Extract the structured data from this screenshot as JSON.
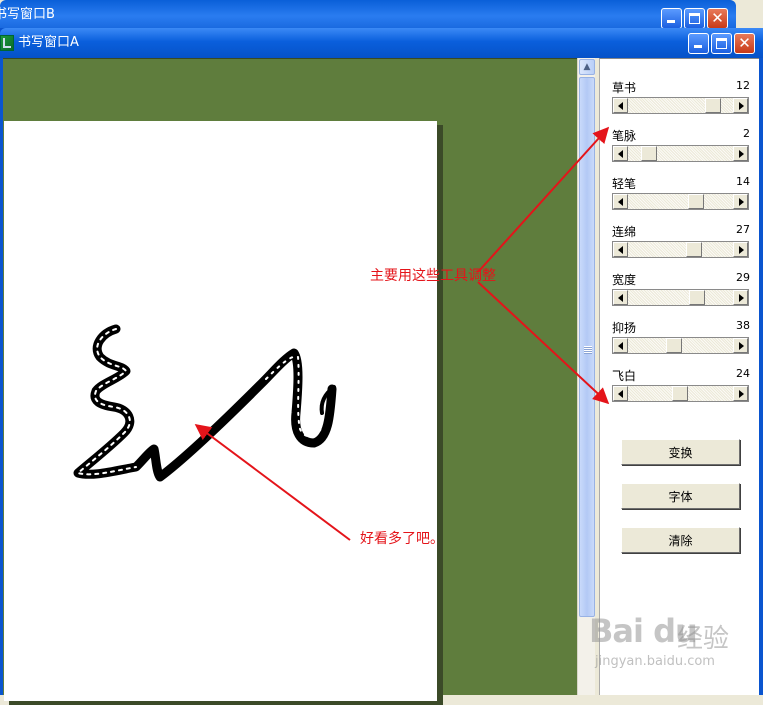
{
  "window_b": {
    "title": "书写窗口B"
  },
  "window_a": {
    "title": "书写窗口A"
  },
  "panel": {
    "sliders": [
      {
        "label": "草书",
        "value": "12",
        "level": 0.85
      },
      {
        "label": "笔脉",
        "value": "2",
        "level": 0.14
      },
      {
        "label": "轻笔",
        "value": "14",
        "level": 0.66
      },
      {
        "label": "连绵",
        "value": "27",
        "level": 0.64
      },
      {
        "label": "宽度",
        "value": "29",
        "level": 0.67
      },
      {
        "label": "抑扬",
        "value": "38",
        "level": 0.42
      },
      {
        "label": "飞白",
        "value": "24",
        "level": 0.48
      }
    ],
    "buttons": [
      {
        "label": "变换"
      },
      {
        "label": "字体"
      },
      {
        "label": "清除"
      }
    ]
  },
  "annotations": {
    "tools": "主要用这些工具调整",
    "result": "好看多了吧。"
  },
  "watermark": {
    "brand": "Bai du",
    "cn": "经验",
    "url": "jingyan.baidu.com"
  },
  "colors": {
    "canvas_bg": "#5f7d3d",
    "annotation": "#e4141a",
    "titlebar": "#0a5fdc"
  }
}
